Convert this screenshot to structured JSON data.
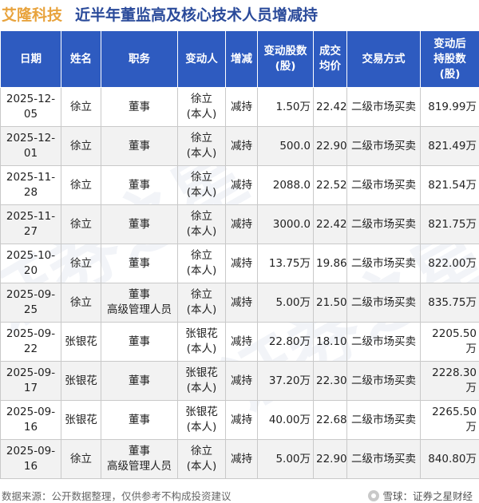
{
  "header": {
    "company": "艾隆科技",
    "title": "近半年董监高及核心技术人员增减持"
  },
  "table": {
    "columns": [
      "日期",
      "姓名",
      "职务",
      "变动人",
      "增减",
      "变动股数\n(股)",
      "成交\n均价",
      "交易方式",
      "变动后\n持股数\n(股)"
    ],
    "rows": [
      {
        "date": "2025-12-05",
        "name": "徐立",
        "role": "董事",
        "changer": "徐立\n(本人)",
        "direction": "减持",
        "shares": "1.50万",
        "price": "22.42",
        "method": "二级市场买卖",
        "after": "819.99万"
      },
      {
        "date": "2025-12-01",
        "name": "徐立",
        "role": "董事",
        "changer": "徐立\n(本人)",
        "direction": "减持",
        "shares": "500.0",
        "price": "22.90",
        "method": "二级市场买卖",
        "after": "821.49万"
      },
      {
        "date": "2025-11-28",
        "name": "徐立",
        "role": "董事",
        "changer": "徐立\n(本人)",
        "direction": "减持",
        "shares": "2088.0",
        "price": "22.52",
        "method": "二级市场买卖",
        "after": "821.54万"
      },
      {
        "date": "2025-11-27",
        "name": "徐立",
        "role": "董事",
        "changer": "徐立\n(本人)",
        "direction": "减持",
        "shares": "3000.0",
        "price": "22.42",
        "method": "二级市场买卖",
        "after": "821.75万"
      },
      {
        "date": "2025-10-20",
        "name": "徐立",
        "role": "董事",
        "changer": "徐立\n(本人)",
        "direction": "减持",
        "shares": "13.75万",
        "price": "19.86",
        "method": "二级市场买卖",
        "after": "822.00万"
      },
      {
        "date": "2025-09-25",
        "name": "徐立",
        "role": "董事\n高级管理人员",
        "changer": "徐立\n(本人)",
        "direction": "减持",
        "shares": "5.00万",
        "price": "21.50",
        "method": "二级市场买卖",
        "after": "835.75万"
      },
      {
        "date": "2025-09-22",
        "name": "张银花",
        "role": "董事",
        "changer": "张银花\n(本人)",
        "direction": "减持",
        "shares": "22.80万",
        "price": "18.10",
        "method": "二级市场买卖",
        "after": "2205.50万"
      },
      {
        "date": "2025-09-17",
        "name": "张银花",
        "role": "董事",
        "changer": "张银花\n(本人)",
        "direction": "减持",
        "shares": "37.20万",
        "price": "22.30",
        "method": "二级市场买卖",
        "after": "2228.30万"
      },
      {
        "date": "2025-09-16",
        "name": "张银花",
        "role": "董事",
        "changer": "张银花\n(本人)",
        "direction": "减持",
        "shares": "40.00万",
        "price": "22.68",
        "method": "二级市场买卖",
        "after": "2265.50万"
      },
      {
        "date": "2025-09-16",
        "name": "徐立",
        "role": "董事\n高级管理人员",
        "changer": "徐立\n(本人)",
        "direction": "减持",
        "shares": "5.00万",
        "price": "22.90",
        "method": "二级市场买卖",
        "after": "840.80万"
      }
    ]
  },
  "footer": {
    "source": "数据来源：公开数据整理，仅供参考不构成投资建议",
    "brand": "雪球：证券之星财经",
    "brand_icon": "snowball-icon"
  },
  "watermark": {
    "text": "证券之星"
  },
  "colors": {
    "header_bg": "#2e5bc0",
    "company": "#e8a33d",
    "title": "#2a4a9a",
    "decrease": "#2e9b3c"
  }
}
